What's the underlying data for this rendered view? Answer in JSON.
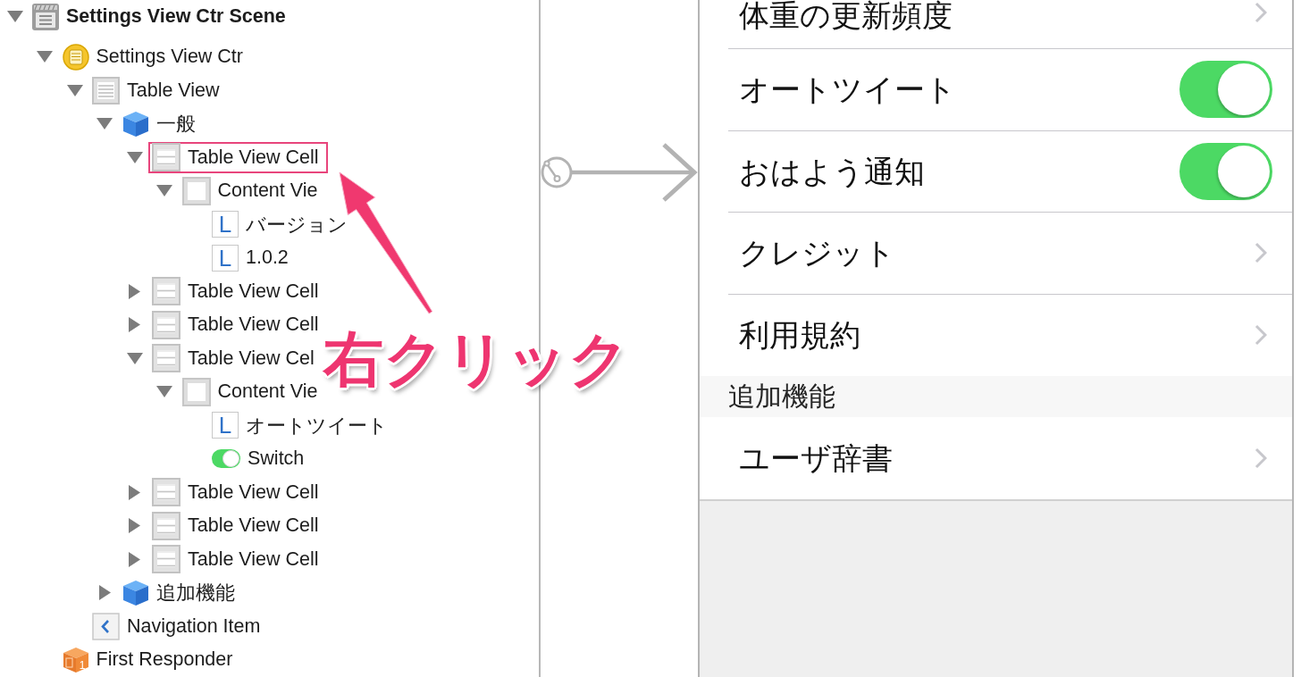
{
  "outline": {
    "items": [
      {
        "label": "Settings View Ctr Scene",
        "kind": "scene",
        "expanded": true,
        "highlighted": false,
        "children": [
          {
            "label": "Settings View Ctr",
            "kind": "controller",
            "expanded": true,
            "highlighted": false,
            "children": [
              {
                "label": "Table View",
                "kind": "table_view",
                "expanded": true,
                "highlighted": false,
                "children": [
                  {
                    "label": "一般",
                    "kind": "section",
                    "expanded": true,
                    "highlighted": false,
                    "children": [
                      {
                        "label": "Table View Cell",
                        "kind": "cell",
                        "expanded": true,
                        "highlighted": true,
                        "children": [
                          {
                            "label": "Content Vie",
                            "kind": "content_view",
                            "expanded": true,
                            "highlighted": false,
                            "children": [
                              {
                                "label": "バージョン",
                                "kind": "label",
                                "icon_letter": "L",
                                "highlighted": false
                              },
                              {
                                "label": "1.0.2",
                                "kind": "label",
                                "icon_letter": "L",
                                "highlighted": false
                              }
                            ]
                          }
                        ]
                      },
                      {
                        "label": "Table View Cell",
                        "kind": "cell",
                        "expanded": false,
                        "highlighted": false
                      },
                      {
                        "label": "Table View Cell",
                        "kind": "cell",
                        "expanded": false,
                        "highlighted": false
                      },
                      {
                        "label": "Table View Cel",
                        "kind": "cell",
                        "expanded": true,
                        "highlighted": false,
                        "children": [
                          {
                            "label": "Content Vie",
                            "kind": "content_view",
                            "expanded": true,
                            "highlighted": false,
                            "children": [
                              {
                                "label": "オートツイート",
                                "kind": "label",
                                "icon_letter": "L",
                                "highlighted": false
                              },
                              {
                                "label": "Switch",
                                "kind": "switch",
                                "highlighted": false
                              }
                            ]
                          }
                        ]
                      },
                      {
                        "label": "Table View Cell",
                        "kind": "cell",
                        "expanded": false,
                        "highlighted": false
                      },
                      {
                        "label": "Table View Cell",
                        "kind": "cell",
                        "expanded": false,
                        "highlighted": false
                      },
                      {
                        "label": "Table View Cell",
                        "kind": "cell",
                        "expanded": false,
                        "highlighted": false
                      }
                    ]
                  },
                  {
                    "label": "追加機能",
                    "kind": "section",
                    "expanded": false,
                    "highlighted": false
                  }
                ]
              },
              {
                "label": "Navigation Item",
                "kind": "navigation_item",
                "highlighted": false
              }
            ]
          },
          {
            "label": "First Responder",
            "kind": "first_responder",
            "icon_letter": "1",
            "highlighted": false
          }
        ]
      }
    ]
  },
  "table": {
    "sections": [
      {
        "rows": [
          {
            "label": "体重の更新頻度",
            "kind": "disclosure"
          },
          {
            "label": "オートツイート",
            "kind": "switch",
            "on": true
          },
          {
            "label": "おはよう通知",
            "kind": "switch",
            "on": true
          },
          {
            "label": "クレジット",
            "kind": "disclosure"
          },
          {
            "label": "利用規約",
            "kind": "disclosure"
          }
        ]
      },
      {
        "header": "追加機能",
        "rows": [
          {
            "label": "ユーザ辞書",
            "kind": "disclosure"
          }
        ]
      }
    ]
  },
  "annotation": {
    "text": "右クリック"
  }
}
